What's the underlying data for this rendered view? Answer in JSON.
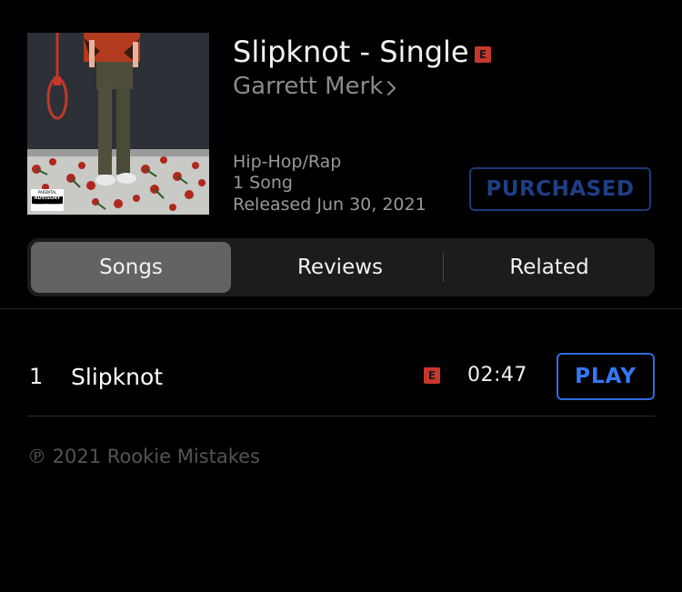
{
  "album": {
    "title": "Slipknot - Single",
    "explicit_badge": "E",
    "artist": "Garrett Merk",
    "genre": "Hip-Hop/Rap",
    "song_count": "1 Song",
    "released": "Released Jun 30, 2021",
    "purchased_label": "PURCHASED",
    "cover_advisory_top": "PARENTAL",
    "cover_advisory_mid": "ADVISORY",
    "cover_advisory_bottom": "EXPLICIT CONTENT"
  },
  "tabs": [
    {
      "label": "Songs",
      "active": true
    },
    {
      "label": "Reviews",
      "active": false
    },
    {
      "label": "Related",
      "active": false
    }
  ],
  "tracks": [
    {
      "number": "1",
      "title": "Slipknot",
      "explicit_badge": "E",
      "duration": "02:47",
      "action_label": "PLAY"
    }
  ],
  "footer": {
    "copyright": "℗ 2021 Rookie Mistakes"
  },
  "colors": {
    "background": "#000000",
    "explicit": "#c8372d",
    "play_accent": "#3478f6",
    "purchased_accent": "#1e3f86",
    "segment_active": "#636366"
  },
  "icons": {
    "artist_chevron": "chevron-right-icon"
  }
}
